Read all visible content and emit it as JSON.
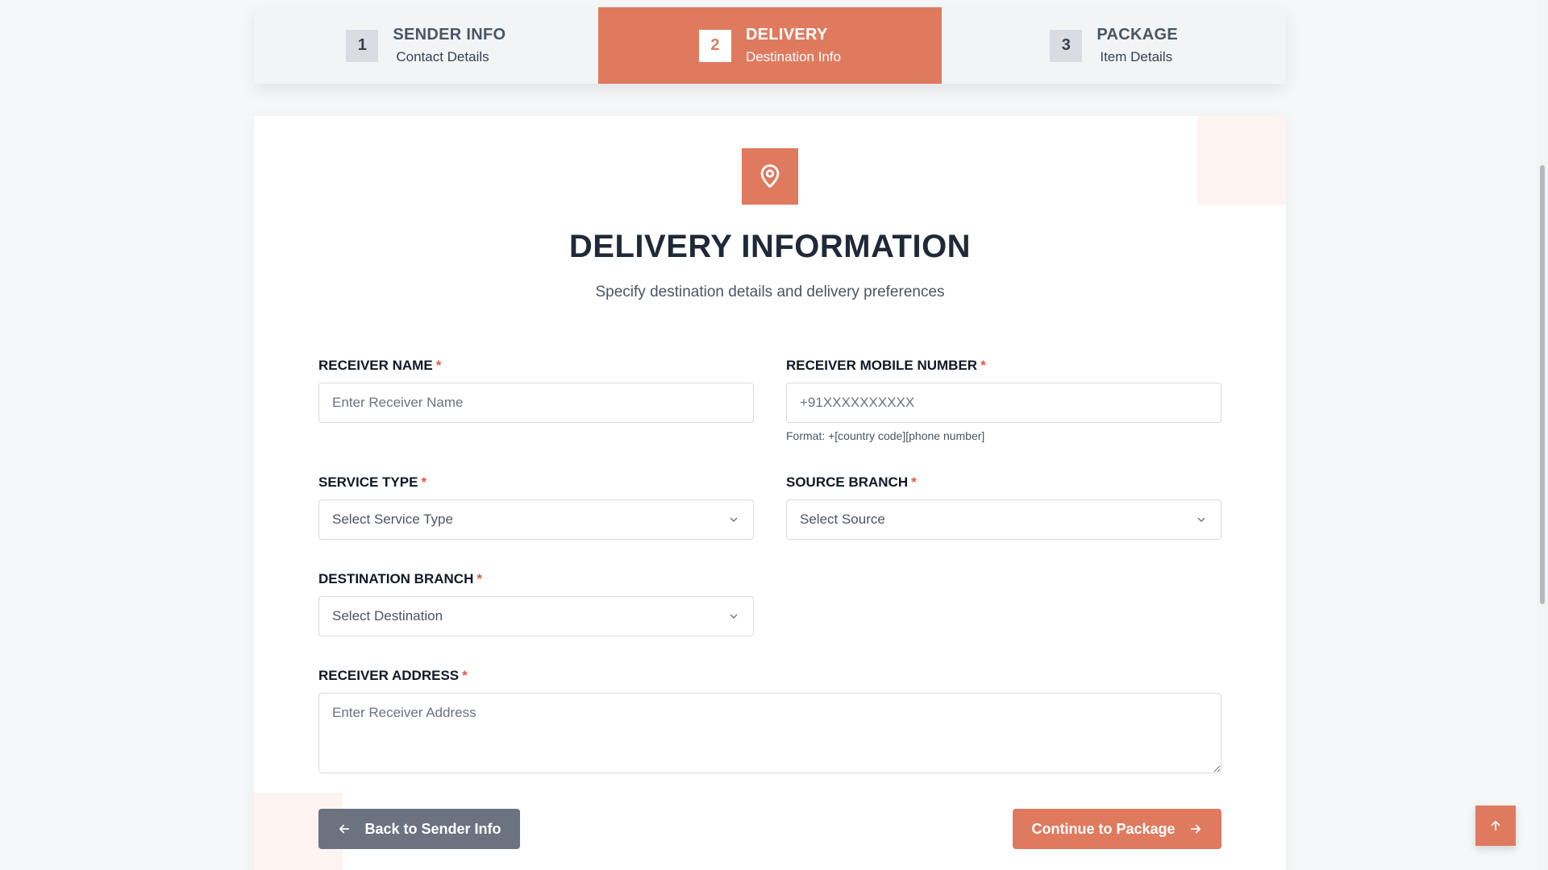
{
  "stepper": [
    {
      "num": "1",
      "title": "SENDER INFO",
      "sub": "Contact Details"
    },
    {
      "num": "2",
      "title": "DELIVERY",
      "sub": "Destination Info"
    },
    {
      "num": "3",
      "title": "PACKAGE",
      "sub": "Item Details"
    }
  ],
  "header": {
    "icon": "map-pin-icon",
    "title": "DELIVERY INFORMATION",
    "subtitle": "Specify destination details and delivery preferences"
  },
  "form": {
    "receiver_name": {
      "label": "RECEIVER NAME",
      "placeholder": "Enter Receiver Name",
      "required": "*"
    },
    "receiver_mobile": {
      "label": "RECEIVER MOBILE NUMBER",
      "placeholder": "+91XXXXXXXXXX",
      "help": "Format: +[country code][phone number]",
      "required": "*"
    },
    "service_type": {
      "label": "SERVICE TYPE",
      "selected": "Select Service Type",
      "required": "*"
    },
    "source_branch": {
      "label": "SOURCE BRANCH",
      "selected": "Select Source",
      "required": "*"
    },
    "destination_branch": {
      "label": "DESTINATION BRANCH",
      "selected": "Select Destination",
      "required": "*"
    },
    "receiver_address": {
      "label": "RECEIVER ADDRESS",
      "placeholder": "Enter Receiver Address",
      "required": "*"
    }
  },
  "actions": {
    "back_label": "Back to Sender Info",
    "next_label": "Continue to Package"
  },
  "colors": {
    "accent": "#e07a5f",
    "secondary_button": "#6b7280",
    "required": "#e05a47"
  }
}
